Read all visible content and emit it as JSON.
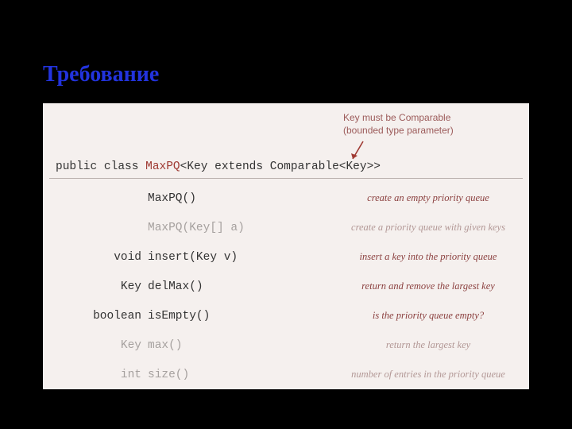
{
  "heading": "Требование",
  "annotation": {
    "line1": "Key must be Comparable",
    "line2": "(bounded type parameter)"
  },
  "signature": {
    "prefix": "public class ",
    "classname": "MaxPQ",
    "suffix": "<Key extends Comparable<Key>>"
  },
  "api": [
    {
      "dim": false,
      "ret": "",
      "sig": "MaxPQ()",
      "desc": "create an empty priority queue"
    },
    {
      "dim": true,
      "ret": "",
      "sig": "MaxPQ(Key[] a)",
      "desc": "create a priority queue with given keys"
    },
    {
      "dim": false,
      "ret": "void",
      "sig": "insert(Key v)",
      "desc": "insert a key into the priority queue"
    },
    {
      "dim": false,
      "ret": "Key",
      "sig": "delMax()",
      "desc": "return and remove the largest key"
    },
    {
      "dim": false,
      "ret": "boolean",
      "sig": "isEmpty()",
      "desc": "is the priority queue empty?"
    },
    {
      "dim": true,
      "ret": "Key",
      "sig": "max()",
      "desc": "return the largest key"
    },
    {
      "dim": true,
      "ret": "int",
      "sig": "size()",
      "desc": "number of entries in the priority queue"
    }
  ]
}
